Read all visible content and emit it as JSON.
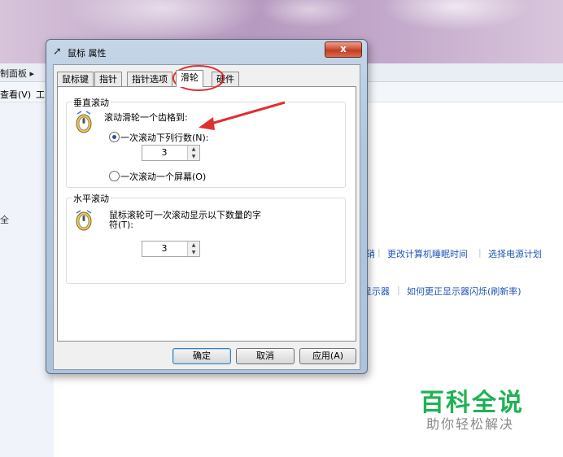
{
  "background": {
    "breadcrumb": "制面板 ▸",
    "menu": {
      "view": "查看(V)",
      "tools": "工"
    },
    "left_text": "全",
    "links_row1": [
      "硝",
      "更改计算机睡眠时间",
      "选择电源计划"
    ],
    "links_row2": [
      "显示器",
      "如何更正显示器闪烁(刷新率)"
    ]
  },
  "dialog": {
    "title": "鼠标 属性",
    "close_label": "x",
    "tabs": [
      "鼠标键",
      "指针",
      "指针选项",
      "滑轮",
      "硬件"
    ],
    "active_tab": "滑轮",
    "vertical": {
      "group_title": "垂直滚动",
      "prompt": "滚动滑轮一个齿格到:",
      "option_lines": "一次滚动下列行数(N):",
      "lines_value": "3",
      "option_screen": "一次滚动一个屏幕(O)",
      "selected": "lines"
    },
    "horizontal": {
      "group_title": "水平滚动",
      "prompt_line1": "鼠标滚轮可一次滚动显示以下数量的字",
      "prompt_line2": "符(T):",
      "chars_value": "3"
    },
    "buttons": {
      "ok": "确定",
      "cancel": "取消",
      "apply": "应用(A)"
    }
  },
  "watermark": {
    "title": "百科全说",
    "subtitle": "助你轻松解决"
  },
  "colors": {
    "annotation": "#e03030",
    "link": "#1f57b8",
    "watermark": "#1fb254"
  }
}
